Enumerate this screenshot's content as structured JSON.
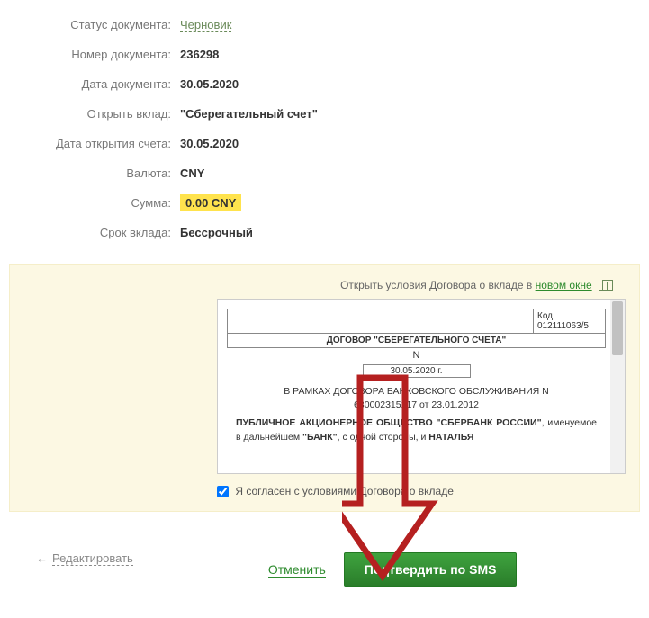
{
  "form": {
    "status_label": "Статус документа:",
    "status_value": "Черновик",
    "number_label": "Номер документа:",
    "number_value": "236298",
    "date_label": "Дата документа:",
    "date_value": "30.05.2020",
    "deposit_label": "Открыть вклад:",
    "deposit_value": "\"Сберегательный счет\"",
    "open_date_label": "Дата открытия счета:",
    "open_date_value": "30.05.2020",
    "currency_label": "Валюта:",
    "currency_value": "CNY",
    "amount_label": "Сумма:",
    "amount_value": "0.00 CNY",
    "term_label": "Срок вклада:",
    "term_value": "Бессрочный"
  },
  "contract": {
    "open_text": "Открыть условия Договора о вкладе в ",
    "new_window": "новом окне",
    "code_label": "Код",
    "code_value": "012111063/5",
    "title": "ДОГОВОР \"СБЕРЕГАТЕЛЬНОГО СЧЕТА\"",
    "n_label": "N",
    "date_partial": "30.05.2020 г.",
    "body_line1": "В РАМКАХ ДОГОВОРА БАНКОВСКОГО ОБСЛУЖИВАНИЯ N",
    "body_line2": "630002315217 от 23.01.2012",
    "party_text_1": "ПУБЛИЧНОЕ АКЦИОНЕРНОЕ ОБЩЕСТВО \"СБЕРБАНК РОССИИ\"",
    "party_text_2": ", именуемое в дальнейшем ",
    "party_bank": "\"БАНК\"",
    "party_text_3": ", с одной стороны, и ",
    "party_name": "НАТАЛЬЯ"
  },
  "agree": {
    "label": "Я согласен с условиями Договора о вкладе"
  },
  "footer": {
    "edit": "Редактировать",
    "cancel": "Отменить",
    "confirm": "Подтвердить по SMS"
  }
}
